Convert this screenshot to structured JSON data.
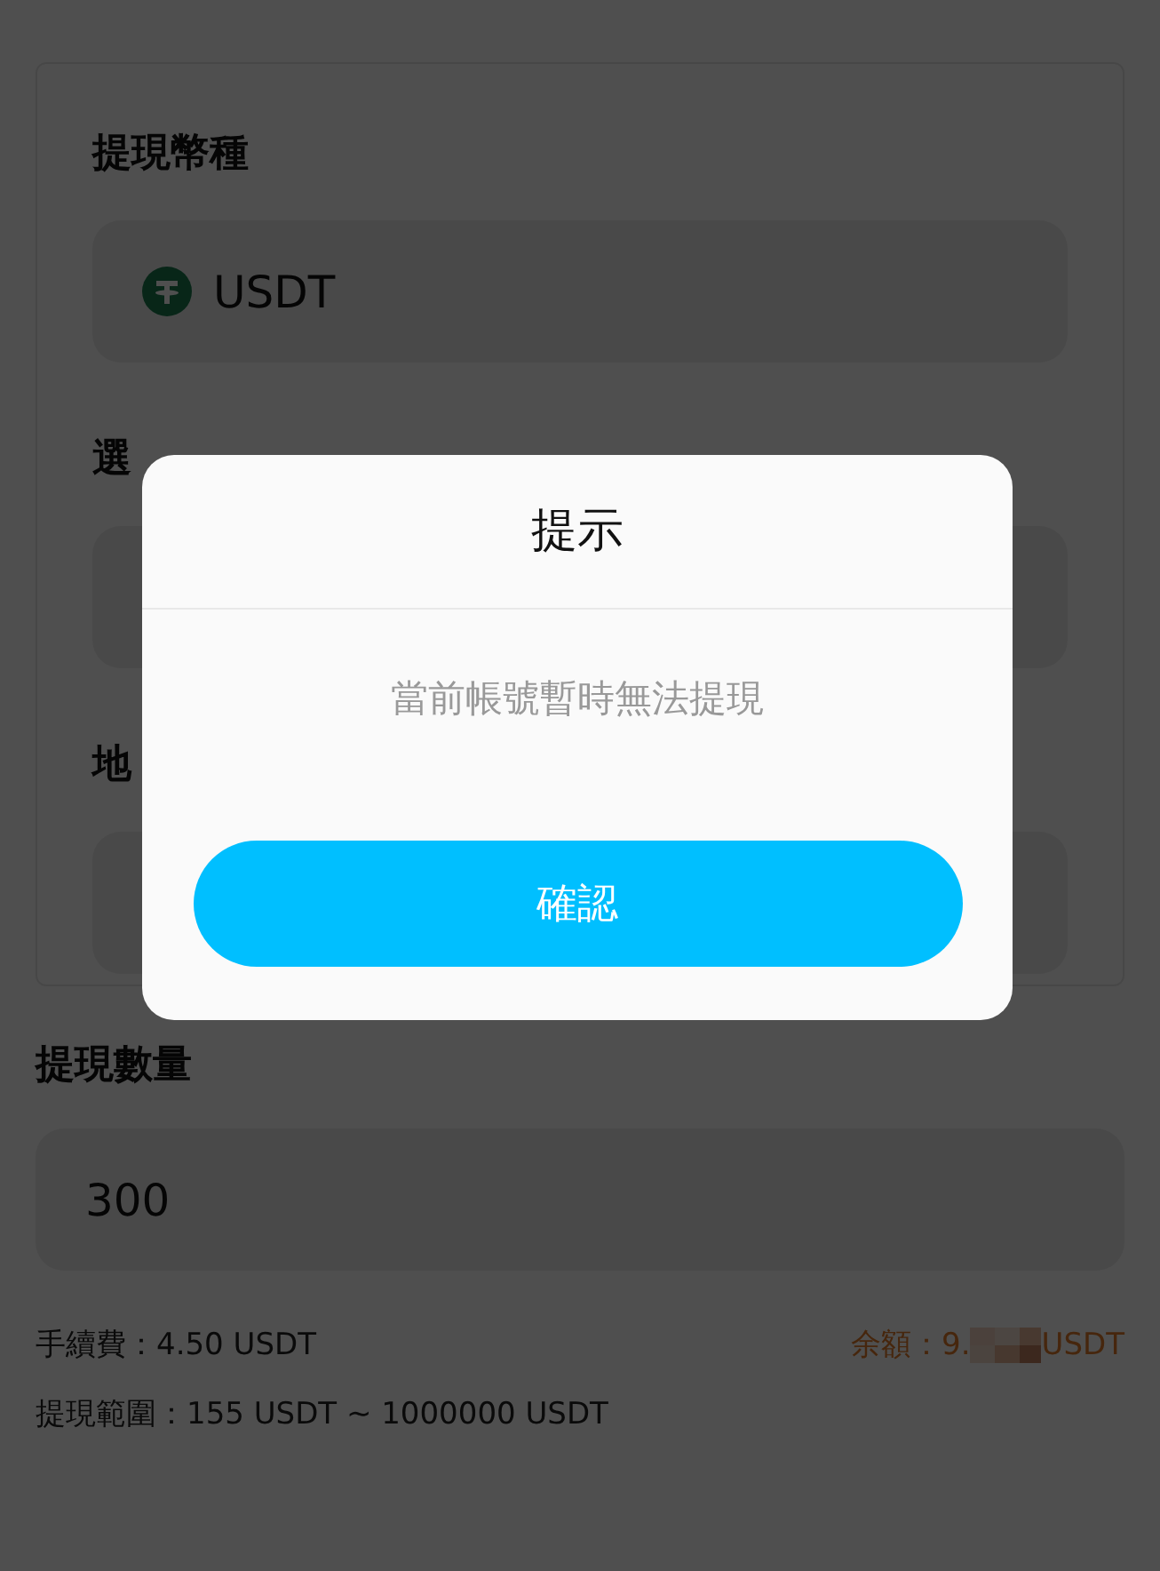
{
  "form": {
    "currency": {
      "label": "提現幣種",
      "value": "USDT"
    },
    "network": {
      "label": "選"
    },
    "address": {
      "label": "地"
    }
  },
  "amount": {
    "label": "提現數量",
    "value": "300"
  },
  "fee": {
    "label": "手續費：",
    "value": "4.50 USDT"
  },
  "balance": {
    "label": "余額：",
    "value": "9.",
    "unit": "USDT"
  },
  "range": {
    "label": "提現範圍：",
    "value": "155 USDT ~ 1000000 USDT"
  },
  "dialog": {
    "title": "提示",
    "message": "當前帳號暫時無法提現",
    "button": "確認"
  }
}
